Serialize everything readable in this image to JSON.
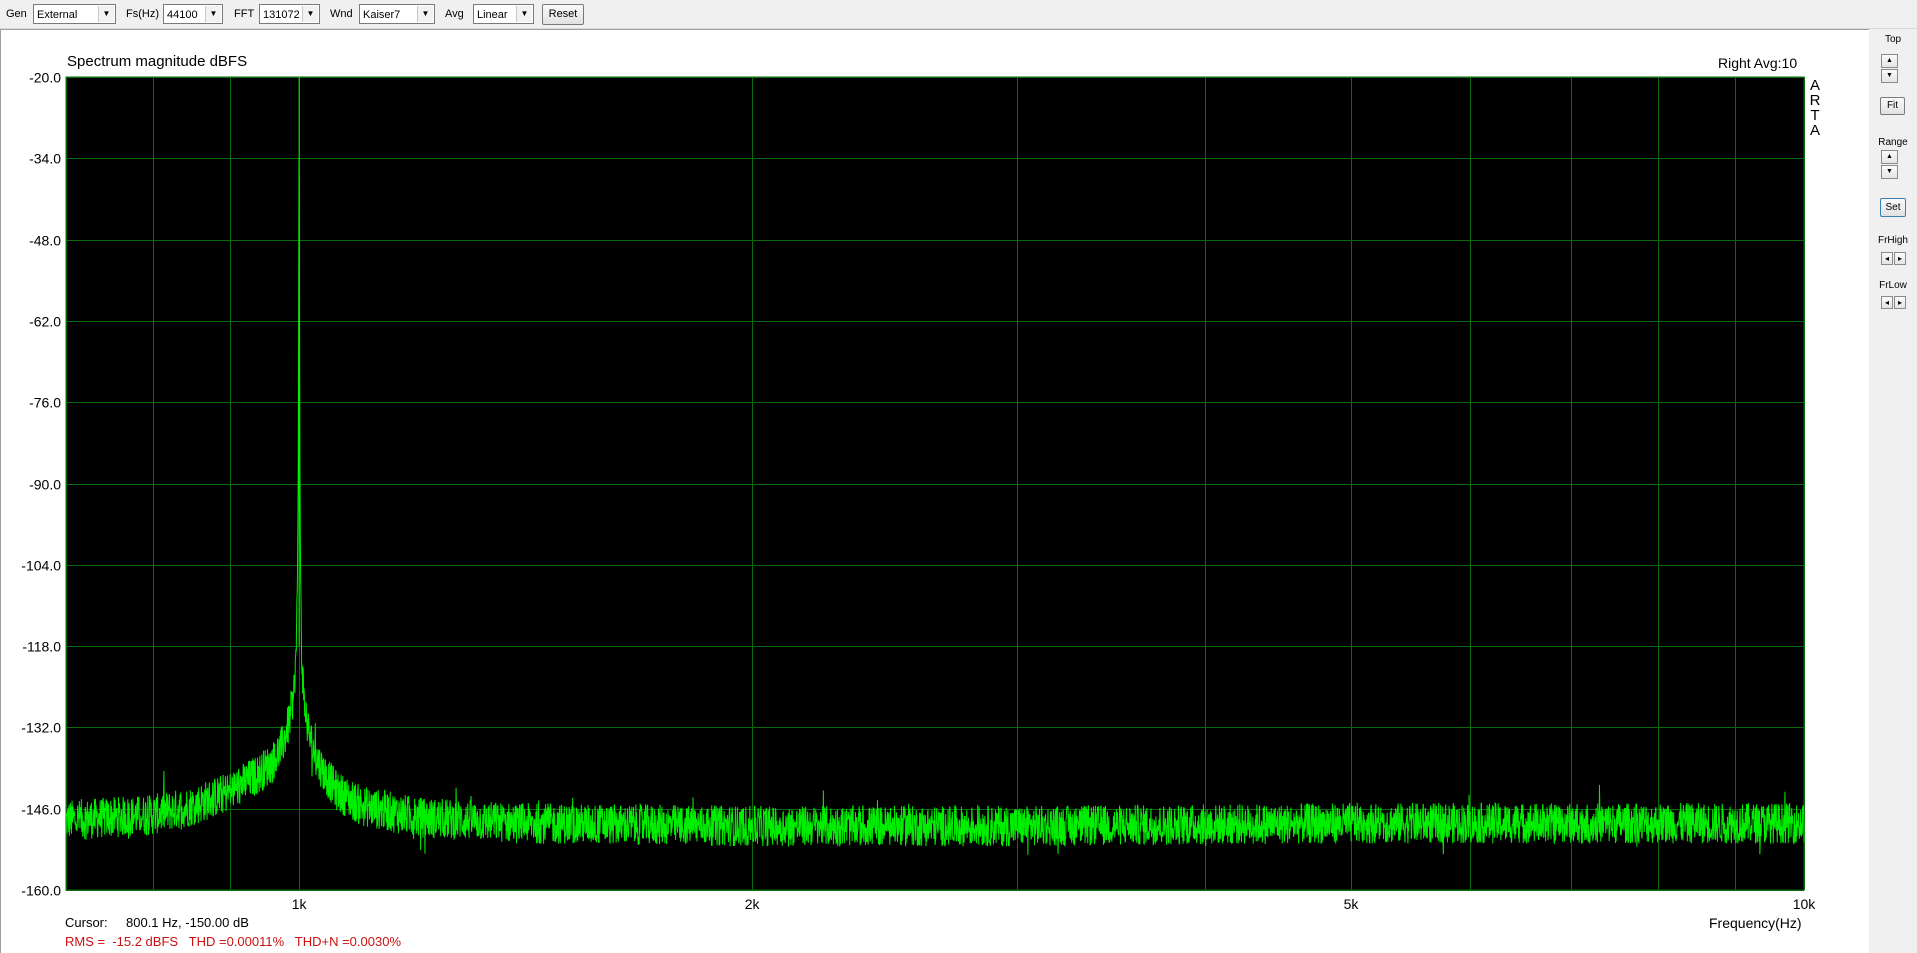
{
  "toolbar": {
    "gen": {
      "label": "Gen",
      "value": "External"
    },
    "fs": {
      "label": "Fs(Hz)",
      "value": "44100"
    },
    "fft": {
      "label": "FFT",
      "value": "131072"
    },
    "wnd": {
      "label": "Wnd",
      "value": "Kaiser7"
    },
    "avg": {
      "label": "Avg",
      "value": "Linear"
    },
    "reset_label": "Reset"
  },
  "plot": {
    "title": "Spectrum magnitude dBFS",
    "channel_info": "Right  Avg:10",
    "watermark": [
      "A",
      "R",
      "T",
      "A"
    ],
    "cursor_label": "Cursor:",
    "cursor_value": "800.1 Hz, -150.00 dB",
    "stats": "RMS =  -15.2 dBFS   THD =0.00011%   THD+N =0.0030%",
    "colors": {
      "background": "#000000",
      "grid": "#0a6b0a",
      "trace": "#00ee00",
      "stats_text": "#cc1111"
    }
  },
  "right_panel": {
    "top_label": "Top",
    "fit_label": "Fit",
    "range_label": "Range",
    "set_label": "Set",
    "frhigh_label": "FrHigh",
    "frlow_label": "FrLow"
  },
  "chart_data": {
    "type": "line",
    "xscale": "log",
    "xlim": [
      700,
      10000
    ],
    "ylim": [
      -160,
      -20
    ],
    "xlabel": "Frequency(Hz)",
    "ylabel": "",
    "grid": true,
    "y_ticks": [
      "-20.0",
      "-34.0",
      "-48.0",
      "-62.0",
      "-76.0",
      "-90.0",
      "-104.0",
      "-118.0",
      "-132.0",
      "-146.0",
      "-160.0"
    ],
    "y_tick_values": [
      -20,
      -34,
      -48,
      -62,
      -76,
      -90,
      -104,
      -118,
      -132,
      -146,
      -160
    ],
    "x_ticks": [
      {
        "label": "1k",
        "value": 1000
      },
      {
        "label": "2k",
        "value": 2000
      },
      {
        "label": "5k",
        "value": 5000
      },
      {
        "label": "10k",
        "value": 10000
      }
    ],
    "x_grid": [
      700,
      800,
      900,
      1000,
      2000,
      3000,
      4000,
      5000,
      6000,
      7000,
      8000,
      9000,
      10000
    ],
    "series": [
      {
        "x": [
          700,
          800,
          850,
          900,
          940,
          960,
          975,
          985,
          992,
          996,
          998,
          999,
          1000,
          1001,
          1002,
          1004,
          1008,
          1015,
          1025,
          1040,
          1060,
          1100,
          1200,
          1400,
          2000,
          3000,
          5000,
          7000,
          10000
        ],
        "y": [
          -148,
          -147,
          -145.5,
          -143,
          -140,
          -138,
          -135,
          -131,
          -126,
          -118,
          -100,
          -80,
          -20,
          -82,
          -103,
          -120,
          -128,
          -133,
          -137,
          -140,
          -143,
          -145.5,
          -147.5,
          -148.5,
          -149,
          -149,
          -148.5,
          -148.5,
          -148.5
        ]
      }
    ]
  }
}
